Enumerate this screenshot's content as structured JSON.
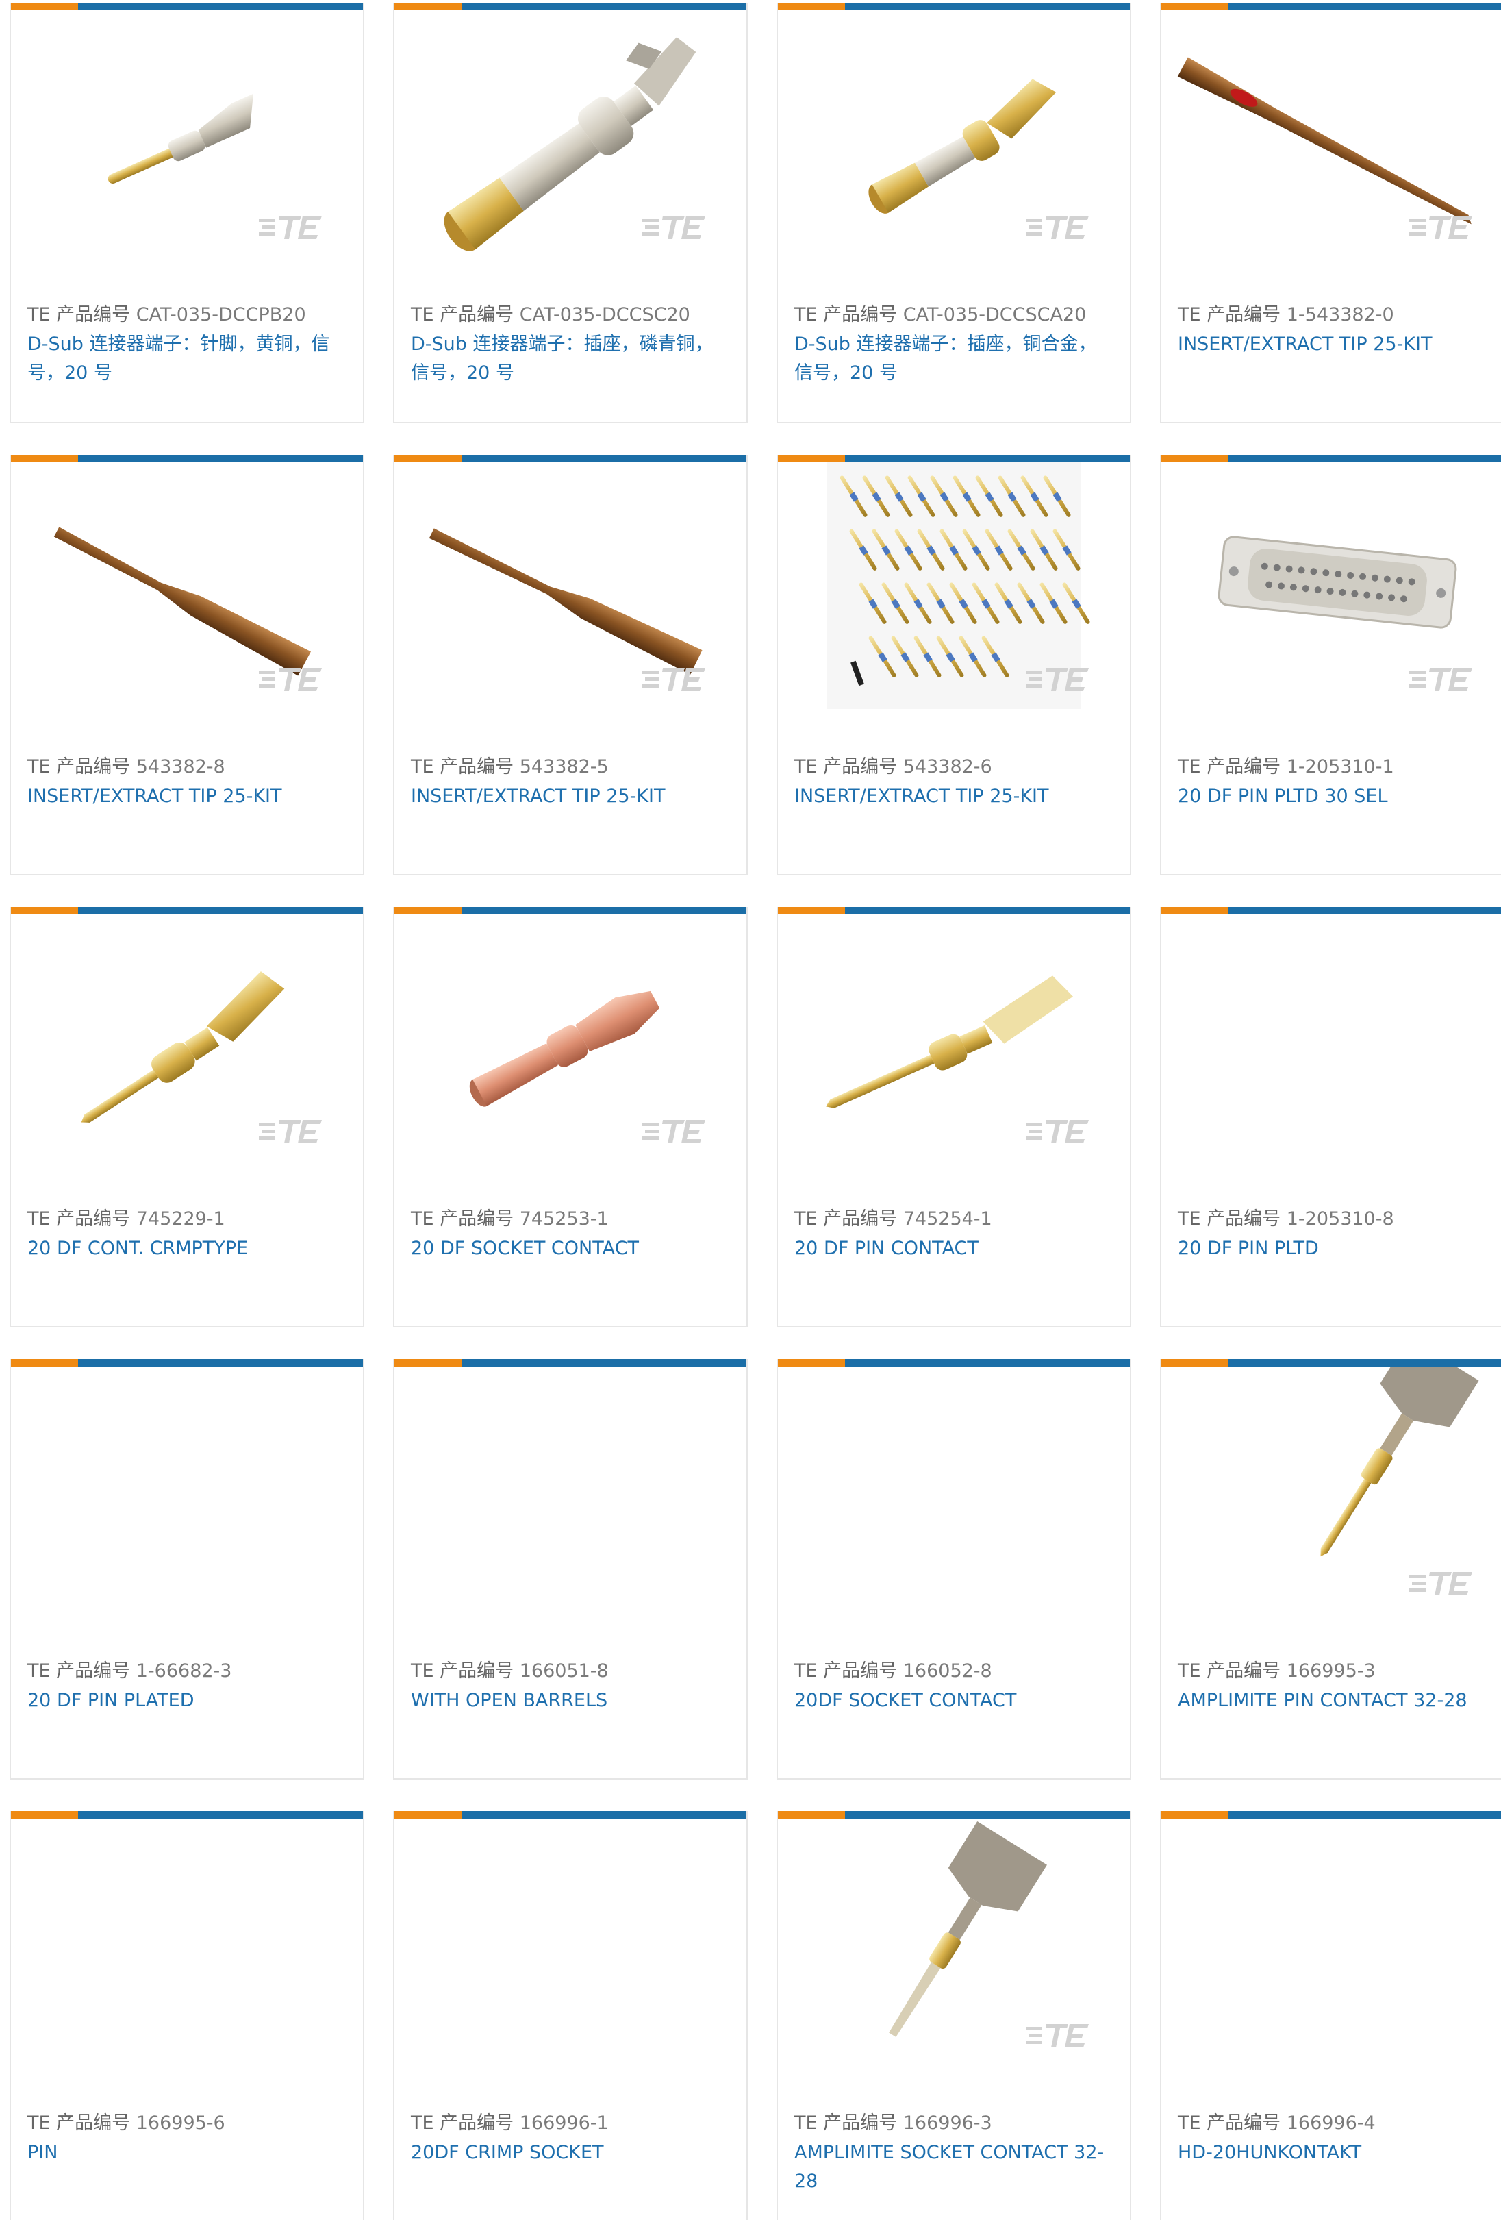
{
  "brand_colors": {
    "accent_orange": "#ef8a13",
    "accent_blue": "#1b6ea7",
    "link": "#1e6fae",
    "label": "#7a7a7a"
  },
  "cards": [
    {
      "label": "TE 产品编号",
      "part_number": "CAT-035-DCCPB20",
      "description": "D-Sub 连接器端子：针脚，黄铜，信号，20 号",
      "image": "pin-contact-small",
      "logo": "TE"
    },
    {
      "label": "TE 产品编号",
      "part_number": "CAT-035-DCCSC20",
      "description": "D-Sub 连接器端子：插座，磷青铜，信号，20 号",
      "image": "socket-contact-large",
      "logo": "TE"
    },
    {
      "label": "TE 产品编号",
      "part_number": "CAT-035-DCCSCA20",
      "description": "D-Sub 连接器端子：插座，铜合金，信号，20 号",
      "image": "socket-contact-gold",
      "logo": "TE"
    },
    {
      "label": "TE 产品编号",
      "part_number": "1-543382-0",
      "description": "INSERT/EXTRACT TIP 25-KIT",
      "image": "extract-tip-red",
      "logo": "TE"
    },
    {
      "label": "TE 产品编号",
      "part_number": "543382-8",
      "description": "INSERT/EXTRACT TIP 25-KIT",
      "image": "extract-tip-brown",
      "logo": "TE"
    },
    {
      "label": "TE 产品编号",
      "part_number": "543382-5",
      "description": "INSERT/EXTRACT TIP 25-KIT",
      "image": "extract-tip-brown-2",
      "logo": "TE"
    },
    {
      "label": "TE 产品编号",
      "part_number": "543382-6",
      "description": "INSERT/EXTRACT TIP 25-KIT",
      "image": "tip-kit-array",
      "logo": "TE"
    },
    {
      "label": "TE 产品编号",
      "part_number": "1-205310-1",
      "description": "20 DF PIN PLTD 30 SEL",
      "image": "dsub-connector",
      "logo": "TE"
    },
    {
      "label": "TE 产品编号",
      "part_number": "745229-1",
      "description": "20 DF CONT. CRMPTYPE",
      "image": "crimp-pin-gold",
      "logo": "TE"
    },
    {
      "label": "TE 产品编号",
      "part_number": "745253-1",
      "description": "20 DF SOCKET CONTACT",
      "image": "socket-contact-copper",
      "logo": "TE"
    },
    {
      "label": "TE 产品编号",
      "part_number": "745254-1",
      "description": "20 DF PIN CONTACT",
      "image": "pin-contact-gold",
      "logo": "TE"
    },
    {
      "label": "TE 产品编号",
      "part_number": "1-205310-8",
      "description": "20 DF PIN PLTD",
      "image": "none",
      "logo": ""
    },
    {
      "label": "TE 产品编号",
      "part_number": "1-66682-3",
      "description": "20 DF PIN PLATED",
      "image": "none",
      "logo": ""
    },
    {
      "label": "TE 产品编号",
      "part_number": "166051-8",
      "description": "WITH OPEN BARRELS",
      "image": "none",
      "logo": ""
    },
    {
      "label": "TE 产品编号",
      "part_number": "166052-8",
      "description": "20DF SOCKET CONTACT",
      "image": "none",
      "logo": ""
    },
    {
      "label": "TE 产品编号",
      "part_number": "166995-3",
      "description": "AMPLIMITE PIN CONTACT 32-28",
      "image": "amplimite-pin",
      "logo": "TE"
    },
    {
      "label": "TE 产品编号",
      "part_number": "166995-6",
      "description": "PIN",
      "image": "none",
      "logo": ""
    },
    {
      "label": "TE 产品编号",
      "part_number": "166996-1",
      "description": "20DF CRIMP SOCKET",
      "image": "none",
      "logo": ""
    },
    {
      "label": "TE 产品编号",
      "part_number": "166996-3",
      "description": "AMPLIMITE SOCKET CONTACT 32-28",
      "image": "amplimite-socket",
      "logo": "TE"
    },
    {
      "label": "TE 产品编号",
      "part_number": "166996-4",
      "description": "HD-20HUNKONTAKT",
      "image": "none",
      "logo": ""
    }
  ]
}
